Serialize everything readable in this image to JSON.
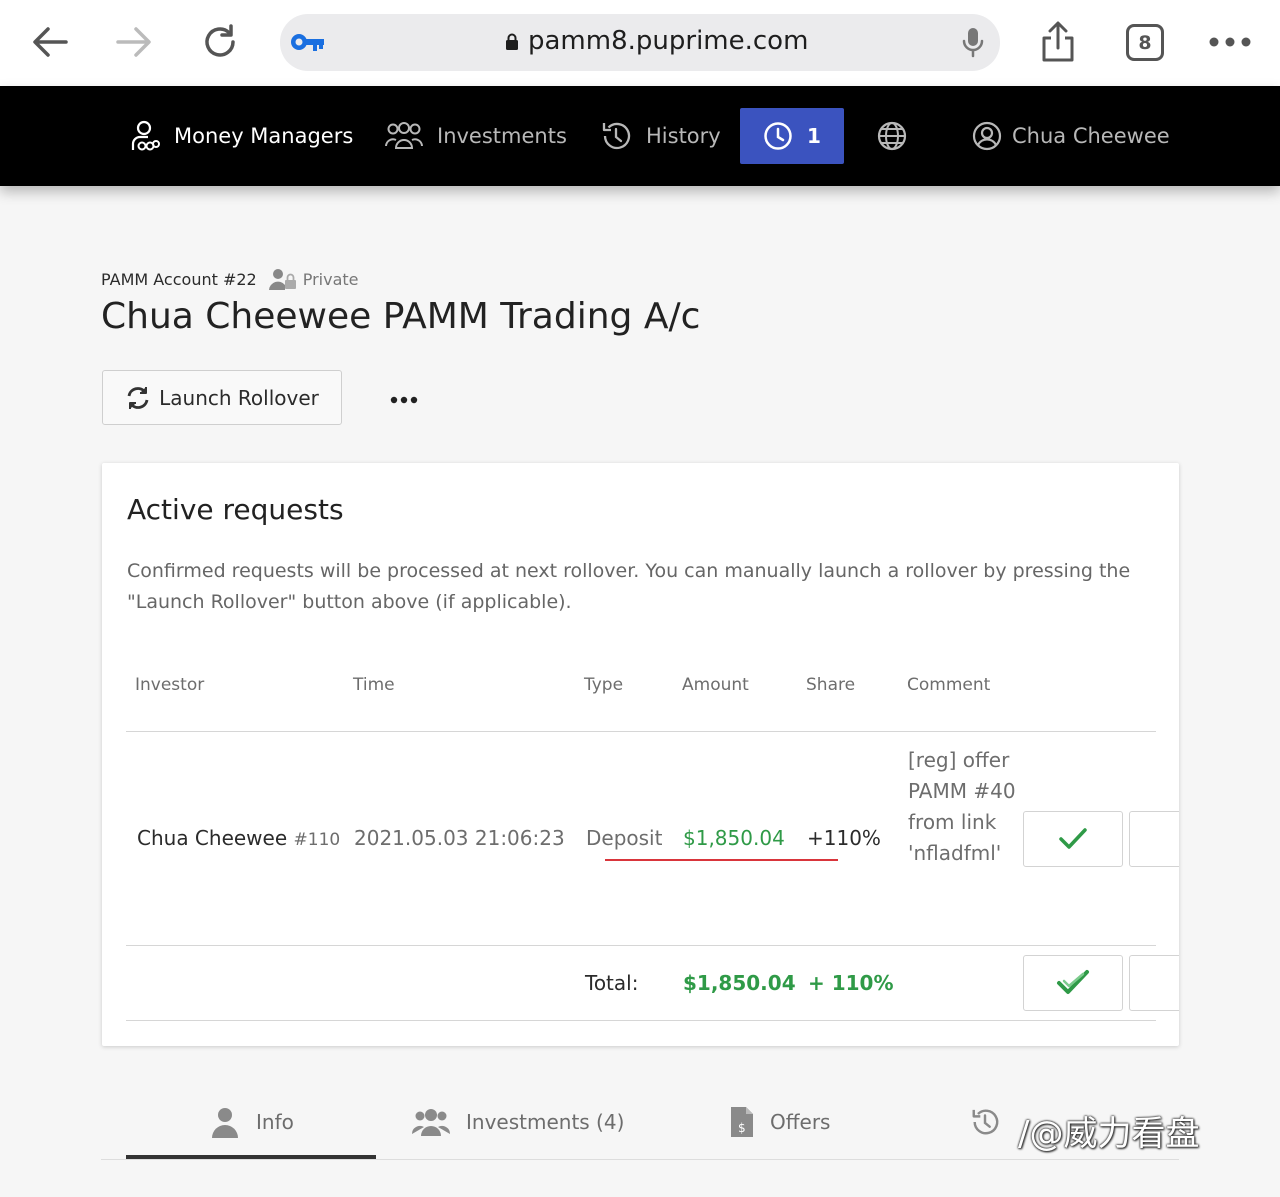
{
  "browser": {
    "url": "pamm8.puprime.com",
    "tab_count": "8"
  },
  "nav": {
    "money_managers": "Money Managers",
    "investments": "Investments",
    "history": "History",
    "pending_count": "1",
    "user_name": "Chua Cheewee",
    "accent_color": "#3b53bf"
  },
  "header": {
    "account_label": "PAMM Account #22",
    "privacy": "Private",
    "title": "Chua Cheewee PAMM Trading A/c",
    "launch_rollover": "Launch Rollover"
  },
  "requests": {
    "title": "Active requests",
    "description": "Confirmed requests will be processed at next rollover. You can manually launch a rollover by pressing the \"Launch Rollover\" button above (if applicable).",
    "columns": [
      "Investor",
      "Time",
      "Type",
      "Amount",
      "Share",
      "Comment"
    ],
    "rows": [
      {
        "investor": "Chua Cheewee",
        "investor_id": "#110",
        "time": "2021.05.03 21:06:23",
        "type": "Deposit",
        "amount": "$1,850.04",
        "share": "+110%",
        "comment": "[reg] offer PAMM #40 from link 'nfladfml'"
      }
    ],
    "total_label": "Total:",
    "total_amount": "$1,850.04",
    "total_share": "+ 110%"
  },
  "tabs": {
    "info": "Info",
    "investments": "Investments (4)",
    "offers": "Offers"
  },
  "watermark": "/@威力看盘"
}
